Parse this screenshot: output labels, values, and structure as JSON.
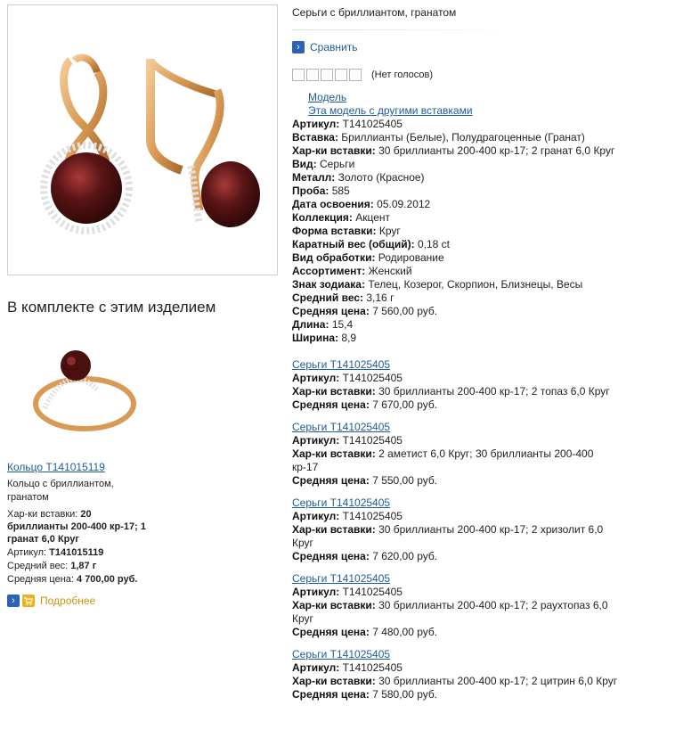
{
  "product": {
    "title": "Серьги с бриллиантом, гранатом",
    "compare_label": "Сравнить",
    "votes_label": "(Нет голосов)",
    "model_link": "Модель",
    "other_inserts_link": "Эта модель с другими вставками",
    "specs": [
      {
        "label": "Артикул:",
        "value": "T141025405"
      },
      {
        "label": "Вставка:",
        "value": "Бриллианты (Белые), Полудрагоценные (Гранат)"
      },
      {
        "label": "Хар-ки вставки:",
        "value": "30 бриллианты 200-400 кр-17; 2 гранат 6,0 Круг"
      },
      {
        "label": "Вид:",
        "value": "Серьги"
      },
      {
        "label": "Металл:",
        "value": "Золото (Красное)"
      },
      {
        "label": "Проба:",
        "value": "585"
      },
      {
        "label": "Дата освоения:",
        "value": "05.09.2012"
      },
      {
        "label": "Коллекция:",
        "value": "Акцент"
      },
      {
        "label": "Форма вставки:",
        "value": "Круг"
      },
      {
        "label": "Каратный вес (общий):",
        "value": "0,18 ct"
      },
      {
        "label": "Вид обработки:",
        "value": "Родирование"
      },
      {
        "label": "Ассортимент:",
        "value": "Женский"
      },
      {
        "label": "Знак зодиака:",
        "value": "Телец, Козерог, Скорпион, Близнецы, Весы"
      },
      {
        "label": "Средний вес:",
        "value": "3,16 г"
      },
      {
        "label": "Средняя цена:",
        "value": "7 560,00 руб."
      },
      {
        "label": "Длина:",
        "value": "15,4"
      },
      {
        "label": "Ширина:",
        "value": "8,9"
      }
    ]
  },
  "variants": [
    {
      "link": "Серьги T141025405",
      "article_label": "Артикул:",
      "article": "T141025405",
      "insert_label": "Хар-ки вставки:",
      "insert": "30 бриллианты 200-400 кр-17; 2 топаз 6,0 Круг",
      "price_label": "Средняя цена:",
      "price": "7 670,00 руб."
    },
    {
      "link": "Серьги T141025405",
      "article_label": "Артикул:",
      "article": "T141025405",
      "insert_label": "Хар-ки вставки:",
      "insert": "2 аметист 6,0 Круг; 30 бриллианты 200-400 кр-17",
      "price_label": "Средняя цена:",
      "price": "7 550,00 руб."
    },
    {
      "link": "Серьги T141025405",
      "article_label": "Артикул:",
      "article": "T141025405",
      "insert_label": "Хар-ки вставки:",
      "insert": "30 бриллианты 200-400 кр-17; 2 хризолит 6,0 Круг",
      "price_label": "Средняя цена:",
      "price": "7 620,00 руб."
    },
    {
      "link": "Серьги T141025405",
      "article_label": "Артикул:",
      "article": "T141025405",
      "insert_label": "Хар-ки вставки:",
      "insert": "30 бриллианты 200-400 кр-17; 2 раухтопаз 6,0 Круг",
      "price_label": "Средняя цена:",
      "price": "7 480,00 руб."
    },
    {
      "link": "Серьги T141025405",
      "article_label": "Артикул:",
      "article": "T141025405",
      "insert_label": "Хар-ки вставки:",
      "insert": "30 бриллианты 200-400 кр-17; 2 цитрин 6,0 Круг",
      "price_label": "Средняя цена:",
      "price": "7 580,00 руб."
    }
  ],
  "kit": {
    "title": "В комплекте с этим изделием",
    "ring_link": "Кольцо T141015119",
    "ring_desc": "Кольцо с бриллиантом, гранатом",
    "insert_label": "Хар-ки вставки:",
    "insert_value": "20 бриллианты 200-400 кр-17; 1 гранат 6,0 Круг",
    "article_label": "Артикул:",
    "article_value": "T141015119",
    "weight_label": "Средний вес:",
    "weight_value": "1,87 г",
    "price_label": "Средняя цена:",
    "price_value": "4 700,00 руб.",
    "more_label": "Подробнее"
  },
  "icons": {
    "compare": "arrow-right-icon",
    "more_arrow": "arrow-right-icon",
    "cart": "cart-icon",
    "rating": "star-box-icon"
  },
  "colors": {
    "link": "#1f5b99",
    "more_link": "#c99410",
    "icon_blue": "#2a63b5",
    "icon_gold": "#f0b21a",
    "gold_metal": "#d99a55",
    "garnet": "#5a1515"
  }
}
